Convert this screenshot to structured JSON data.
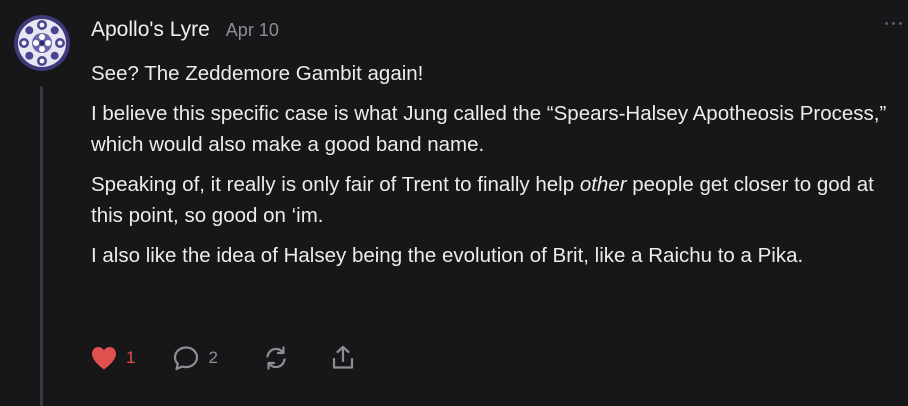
{
  "comment": {
    "author": "Apollo's Lyre",
    "date": "Apr 10",
    "paragraphs": [
      {
        "text": "See? The Zeddemore Gambit again!"
      },
      {
        "text": "I believe this specific case is what Jung called the “Spears-Halsey Apotheosis Process,” which would also make a good band name."
      },
      {
        "before": "Speaking of, it really is only fair of Trent to finally help ",
        "em": "other",
        "after": " people get closer to god at this point, so good on ‘im."
      },
      {
        "text": "I also like the idea of Halsey being the evolution of Brit, like a Raichu to a Pika."
      }
    ],
    "actions": {
      "likes": "1",
      "replies": "2"
    }
  },
  "colors": {
    "background": "#17171a",
    "text": "#ececec",
    "muted": "#8d8d92",
    "like": "#e0504f"
  },
  "icons": {
    "avatar": "mandala-avatar",
    "like": "heart-filled-icon",
    "reply": "speech-bubble-icon",
    "restack": "restack-arrows-icon",
    "share": "share-upload-icon",
    "more": "ellipsis-icon"
  }
}
